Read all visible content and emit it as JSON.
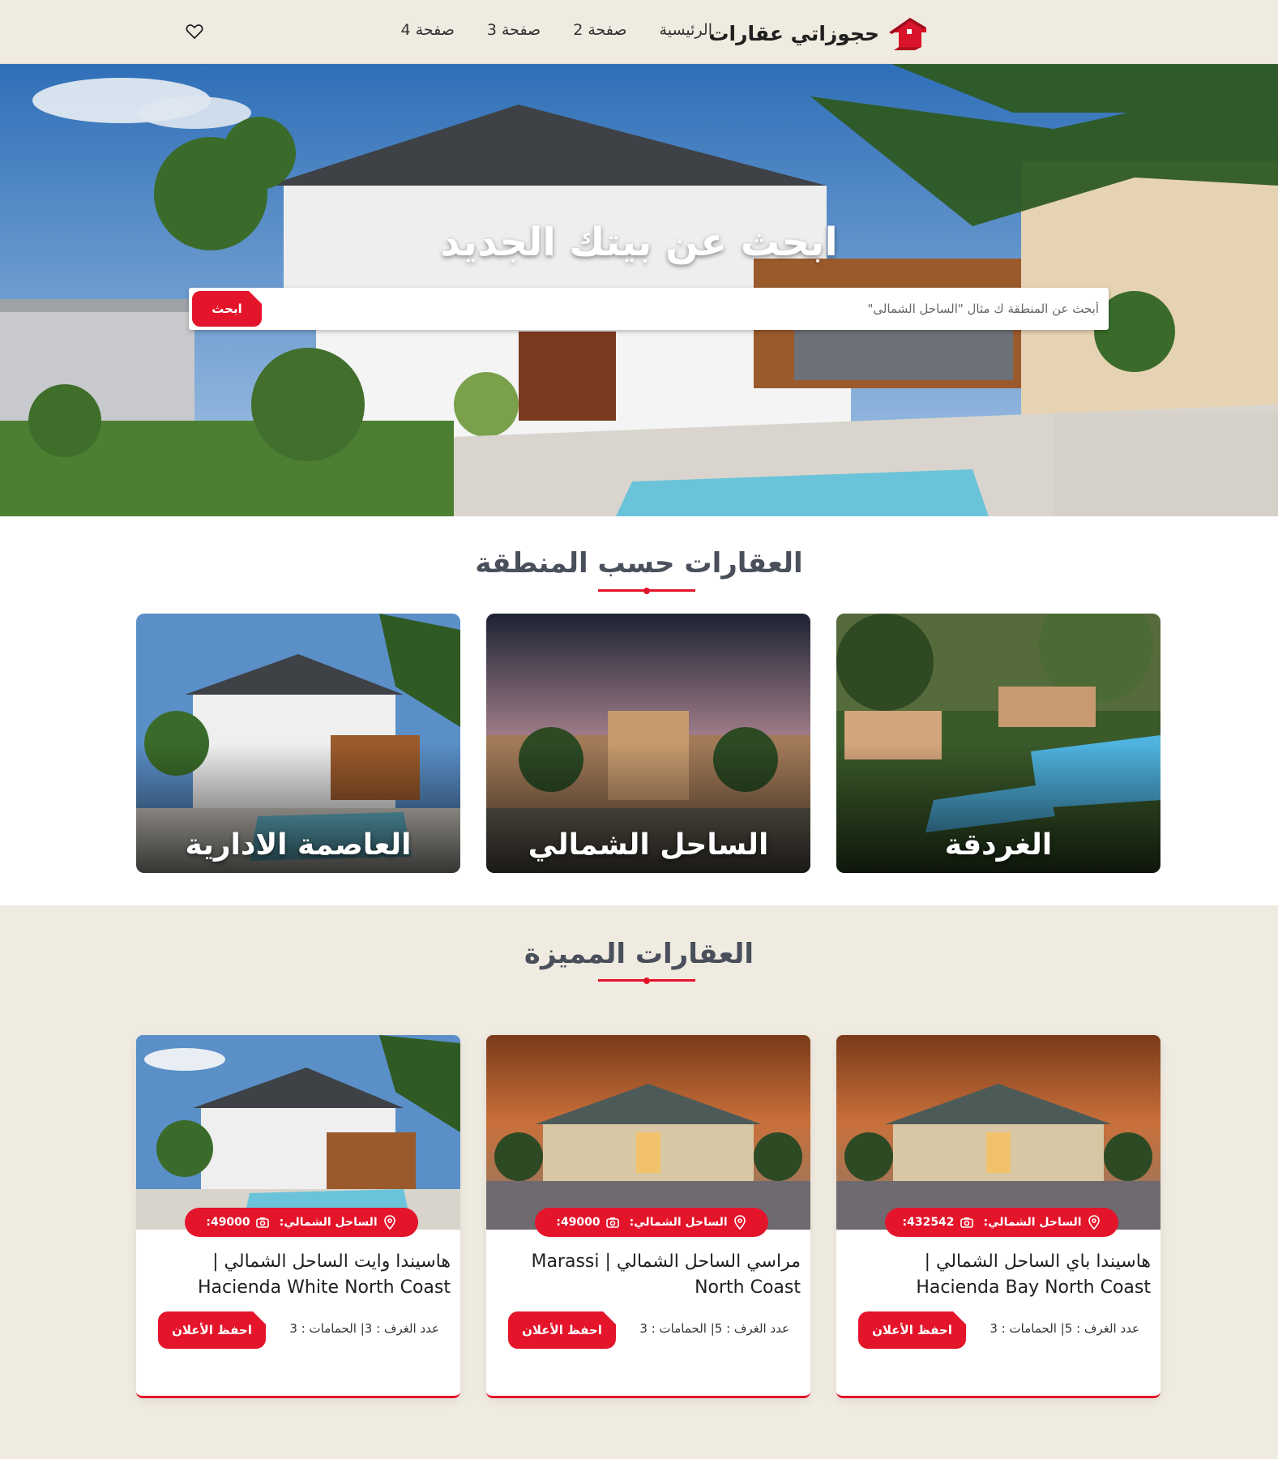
{
  "header": {
    "logo_text": "حجوزاتي عقارات",
    "nav": [
      "الرئيسية",
      "صفحة 2",
      "صفحة 3",
      "صفحة 4"
    ]
  },
  "hero": {
    "title": "ابحث عن بيتك الجديد",
    "search_placeholder": "أبحث عن المنطقة ك مثال \"الساحل الشمالى\"",
    "search_button": "ابحث"
  },
  "areas": {
    "title": "العقارات حسب المنطقة",
    "items": [
      {
        "name": "الغردقة"
      },
      {
        "name": "الساحل الشمالي"
      },
      {
        "name": "العاصمة الادارية"
      }
    ]
  },
  "featured": {
    "title": "العقارات المميزة",
    "items": [
      {
        "location": "الساحل الشمالي:",
        "photos": "432542:",
        "title_line1": "هاسيندا باي الساحل الشمالي |",
        "title_line2": "Hacienda Bay North Coast",
        "meta": "عدد الغرف : 5| الحمامات : 3",
        "button": "احفظ الأعلان"
      },
      {
        "location": "الساحل الشمالي:",
        "photos": "49000:",
        "title_line1": "مراسي الساحل الشمالي | Marassi",
        "title_line2": "North Coast",
        "meta": "عدد الغرف : 5| الحمامات : 3",
        "button": "احفظ الأعلان"
      },
      {
        "location": "الساحل الشمالي:",
        "photos": "49000:",
        "title_line1": "هاسيندا وايت الساحل الشمالي |",
        "title_line2": "Hacienda White North Coast",
        "meta": "عدد الغرف : 3| الحمامات : 3",
        "button": "احفظ الأعلان"
      }
    ]
  },
  "colors": {
    "accent": "#e4142b",
    "beige": "#f0ebe1"
  }
}
